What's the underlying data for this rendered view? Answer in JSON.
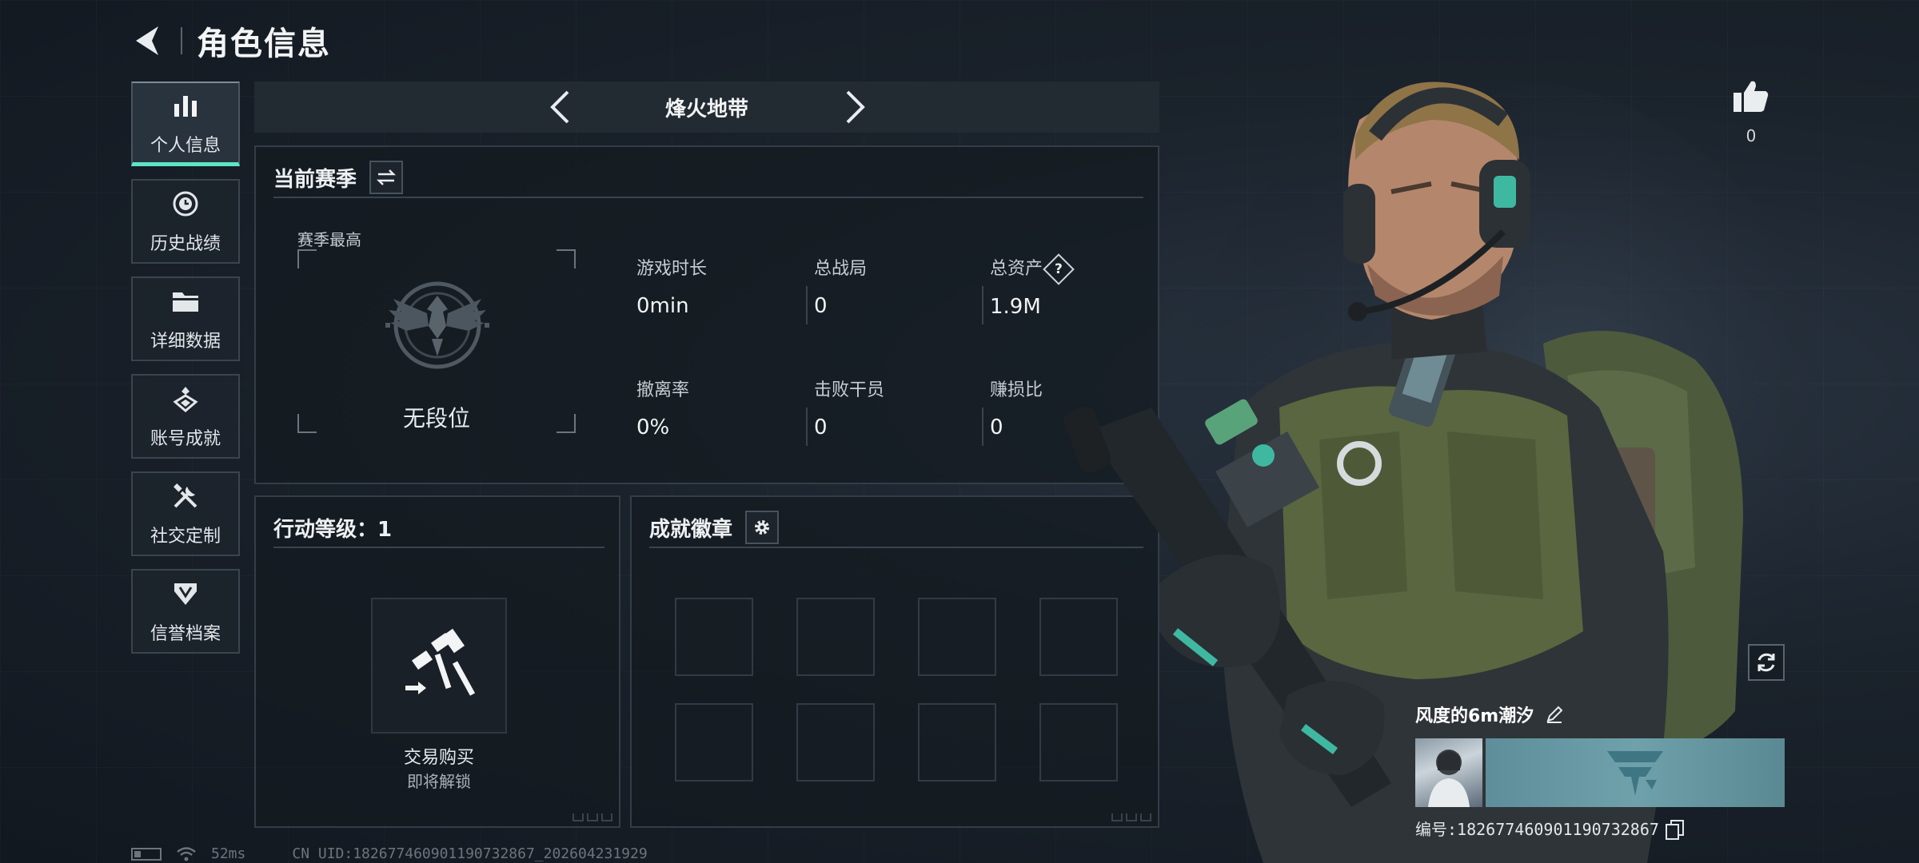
{
  "header": {
    "title": "角色信息"
  },
  "sidebar": {
    "items": [
      {
        "label": "个人信息",
        "icon": "bar-chart-icon",
        "active": true
      },
      {
        "label": "历史战绩",
        "icon": "clock-icon",
        "active": false
      },
      {
        "label": "详细数据",
        "icon": "folder-icon",
        "active": false
      },
      {
        "label": "账号成就",
        "icon": "achievement-icon",
        "active": false
      },
      {
        "label": "社交定制",
        "icon": "tools-icon",
        "active": false
      },
      {
        "label": "信誉档案",
        "icon": "shield-icon",
        "active": false
      }
    ]
  },
  "mode": {
    "title": "烽火地带"
  },
  "season": {
    "title": "当前赛季",
    "rank_caption": "赛季最高",
    "rank_name": "无段位",
    "stats": [
      {
        "label": "游戏时长",
        "value": "0min"
      },
      {
        "label": "总战局",
        "value": "0"
      },
      {
        "label": "总资产",
        "value": "1.9M",
        "help": "?"
      },
      {
        "label": "撤离率",
        "value": "0%"
      },
      {
        "label": "击败干员",
        "value": "0"
      },
      {
        "label": "赚损比",
        "value": "0"
      }
    ]
  },
  "level": {
    "title": "行动等级：1",
    "unlock_name": "交易购买",
    "unlock_status": "即将解锁"
  },
  "achievements": {
    "title": "成就徽章"
  },
  "likes": {
    "count": "0"
  },
  "player": {
    "name": "风度的6m潮汐",
    "id": "编号:1826774609011907328​67"
  },
  "status": {
    "ping": "52ms",
    "uid": "CN UID:182677460901190732867_202604231929"
  },
  "colors": {
    "accent": "#5ee5c8",
    "panel": "#141a20",
    "border": "#343d47"
  }
}
